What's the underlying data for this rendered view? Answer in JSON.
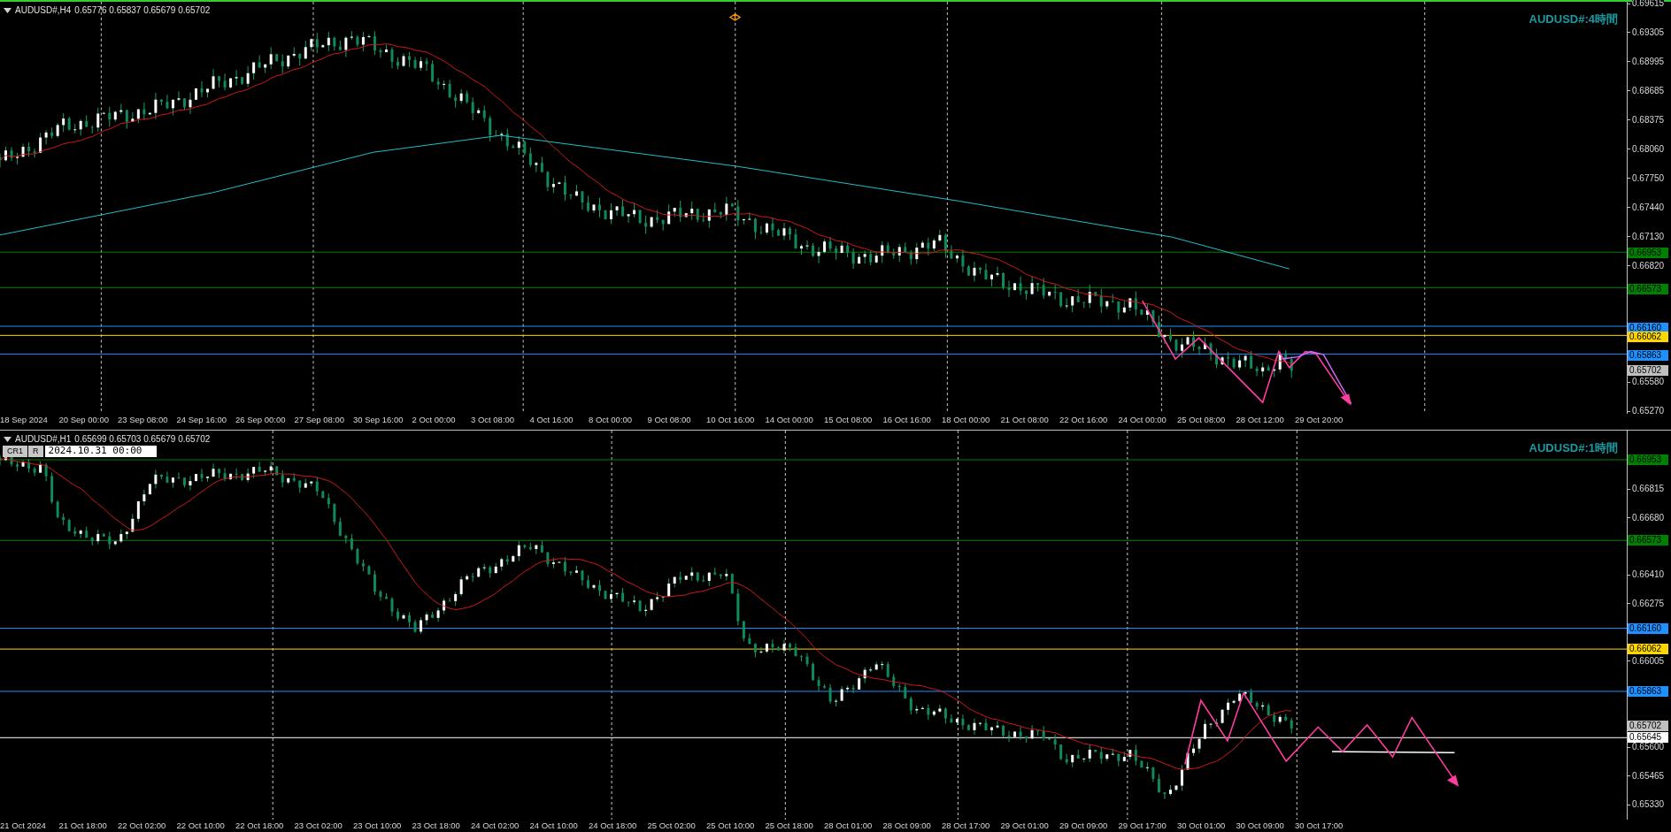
{
  "panes": [
    {
      "header": {
        "symbol": "AUDUSD#,H4",
        "ohlc": "0.65776 0.65837 0.65679 0.65702"
      },
      "watermark": "AUDUSD#:4時間",
      "price_axis": [
        "0.69615",
        "0.69305",
        "0.68995",
        "0.68685",
        "0.68375",
        "0.68060",
        "0.67750",
        "0.67440",
        "0.67130",
        "0.66820",
        "0.65580",
        "0.65270"
      ],
      "levels": [
        {
          "price": "0.66953",
          "kind": "line",
          "color": "#008000"
        },
        {
          "price": "0.66573",
          "kind": "line",
          "color": "#008000"
        },
        {
          "price": "0.66160",
          "kind": "line",
          "color": "#1e90ff"
        },
        {
          "price": "0.66062",
          "kind": "line",
          "color": "#ffd700"
        },
        {
          "price": "0.65863",
          "kind": "line",
          "color": "#1e90ff"
        },
        {
          "price": "0.65702",
          "kind": "bid",
          "color": "#c0c0c0"
        }
      ],
      "time_axis": [
        "18 Sep 2024",
        "20 Sep 00:00",
        "23 Sep 08:00",
        "24 Sep 16:00",
        "26 Sep 00:00",
        "27 Sep 08:00",
        "30 Sep 16:00",
        "2 Oct 00:00",
        "3 Oct 08:00",
        "4 Oct 16:00",
        "8 Oct 00:00",
        "9 Oct 08:00",
        "10 Oct 16:00",
        "14 Oct 00:00",
        "15 Oct 08:00",
        "16 Oct 16:00",
        "18 Oct 00:00",
        "21 Oct 08:00",
        "22 Oct 16:00",
        "24 Oct 00:00",
        "25 Oct 08:00",
        "28 Oct 12:00",
        "29 Oct 20:00"
      ]
    },
    {
      "header": {
        "symbol": "AUDUSD#,H1",
        "ohlc": "0.65699 0.65703 0.65679 0.65702"
      },
      "watermark": "AUDUSD#:1時間",
      "toolbar": {
        "buttons": [
          "CR1",
          "R"
        ],
        "date_field": "2024.10.31 00:00"
      },
      "price_axis": [
        "0.66815",
        "0.66680",
        "0.66410",
        "0.66275",
        "0.66005",
        "0.65600",
        "0.65465",
        "0.65330"
      ],
      "levels": [
        {
          "price": "0.66953",
          "kind": "line",
          "color": "#008000"
        },
        {
          "price": "0.66573",
          "kind": "line",
          "color": "#008000"
        },
        {
          "price": "0.66160",
          "kind": "line",
          "color": "#1e90ff"
        },
        {
          "price": "0.66062",
          "kind": "line",
          "color": "#ffd700"
        },
        {
          "price": "0.65863",
          "kind": "line",
          "color": "#1e90ff"
        },
        {
          "price": "0.65702",
          "kind": "bid",
          "color": "#c0c0c0"
        },
        {
          "price": "0.65645",
          "kind": "line",
          "color": "#ffffff"
        }
      ],
      "time_axis": [
        "21 Oct 2024",
        "21 Oct 18:00",
        "22 Oct 02:00",
        "22 Oct 10:00",
        "22 Oct 18:00",
        "23 Oct 02:00",
        "23 Oct 10:00",
        "23 Oct 18:00",
        "24 Oct 02:00",
        "24 Oct 10:00",
        "24 Oct 18:00",
        "25 Oct 02:00",
        "25 Oct 10:00",
        "25 Oct 18:00",
        "28 Oct 01:00",
        "28 Oct 09:00",
        "28 Oct 17:00",
        "29 Oct 01:00",
        "29 Oct 09:00",
        "29 Oct 17:00",
        "30 Oct 01:00",
        "30 Oct 09:00",
        "30 Oct 17:00"
      ]
    }
  ]
}
